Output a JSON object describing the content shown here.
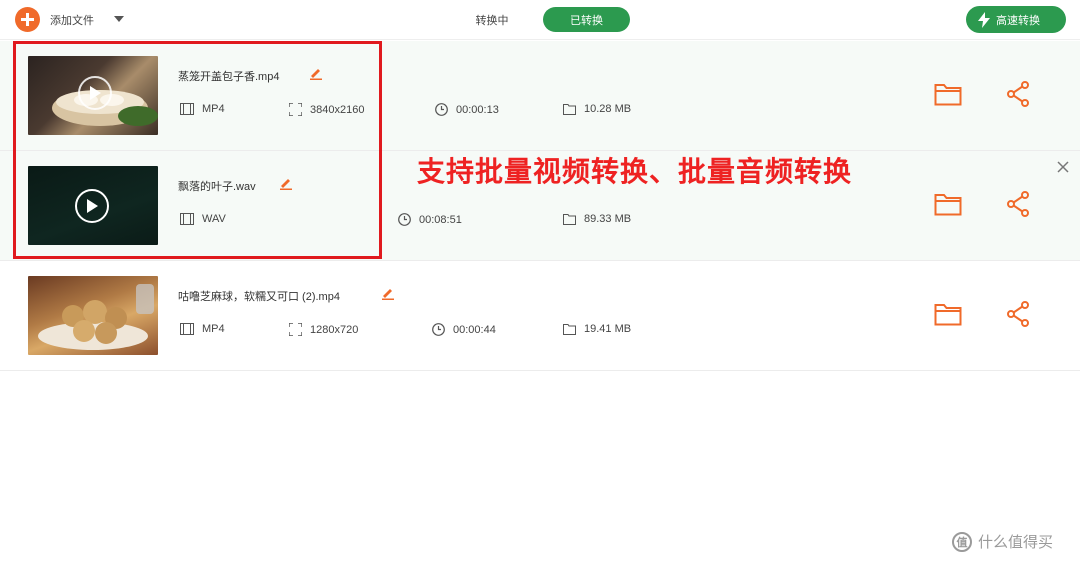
{
  "toolbar": {
    "add_label": "添加文件",
    "tab_converting": "转换中",
    "tab_converted": "已转换",
    "fast_convert": "高速转换"
  },
  "colors": {
    "accent_orange": "#f06a2a",
    "accent_green": "#2c9a4f",
    "highlight_red": "#e0191e"
  },
  "files": [
    {
      "name": "蒸笼开盖包子香.mp4",
      "format": "MP4",
      "resolution": "3840x2160",
      "duration": "00:00:13",
      "size": "10.28 MB"
    },
    {
      "name": "飘落的叶子.wav",
      "format": "WAV",
      "resolution": "",
      "duration": "00:08:51",
      "size": "89.33 MB"
    },
    {
      "name": "咕噜芝麻球，软糯又可口 (2).mp4",
      "format": "MP4",
      "resolution": "1280x720",
      "duration": "00:00:44",
      "size": "19.41 MB"
    }
  ],
  "overlay": {
    "caption": "支持批量视频转换、批量音频转换"
  },
  "watermark": {
    "logo": "值",
    "text": "什么值得买"
  }
}
